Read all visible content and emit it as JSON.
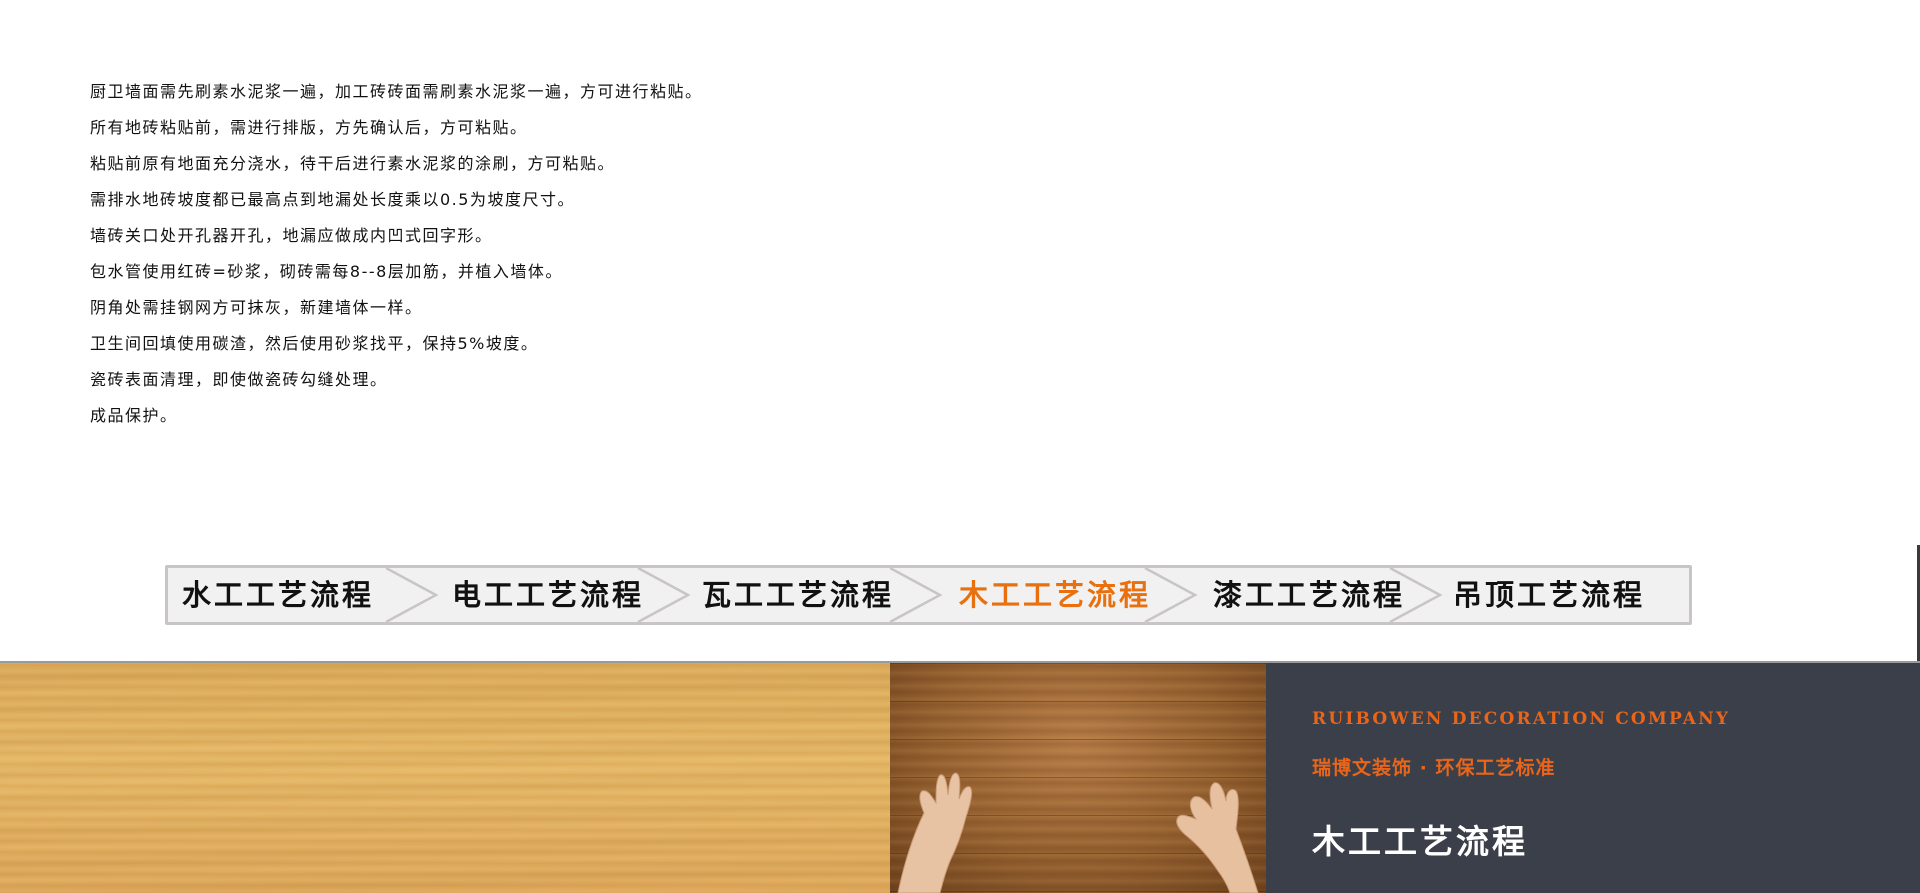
{
  "notes": [
    "厨卫墙面需先刷素水泥浆一遍，加工砖砖面需刷素水泥浆一遍，方可进行粘贴。",
    "所有地砖粘贴前，需进行排版，方先确认后，方可粘贴。",
    "粘贴前原有地面充分浇水，待干后进行素水泥浆的涂刷，方可粘贴。",
    "需排水地砖坡度都已最高点到地漏处长度乘以0.5为坡度尺寸。",
    "墙砖关口处开孔器开孔，地漏应做成内凹式回字形。",
    "包水管使用红砖=砂浆，砌砖需每8--8层加筋，并植入墙体。",
    "阴角处需挂钢网方可抹灰，新建墙体一样。",
    "卫生间回填使用碳渣，然后使用砂浆找平，保持5%坡度。",
    "瓷砖表面清理，即使做瓷砖勾缝处理。",
    "成品保护。"
  ],
  "process_nav": {
    "tabs": [
      {
        "label": "水工工艺流程",
        "active": false
      },
      {
        "label": "电工工艺流程",
        "active": false
      },
      {
        "label": "瓦工工艺流程",
        "active": false
      },
      {
        "label": "木工工艺流程",
        "active": true
      },
      {
        "label": "漆工工艺流程",
        "active": false
      },
      {
        "label": "吊顶工艺流程",
        "active": false
      }
    ],
    "active_color": "#e8700e",
    "text_color": "#111111"
  },
  "banner": {
    "company_en": "RUIBOWEN DECORATION COMPANY",
    "company_cn": "瑞博文装饰 · 环保工艺标准",
    "title": "木工工艺流程",
    "accent_color": "#e8651a",
    "panel_color": "#3b3f49"
  }
}
